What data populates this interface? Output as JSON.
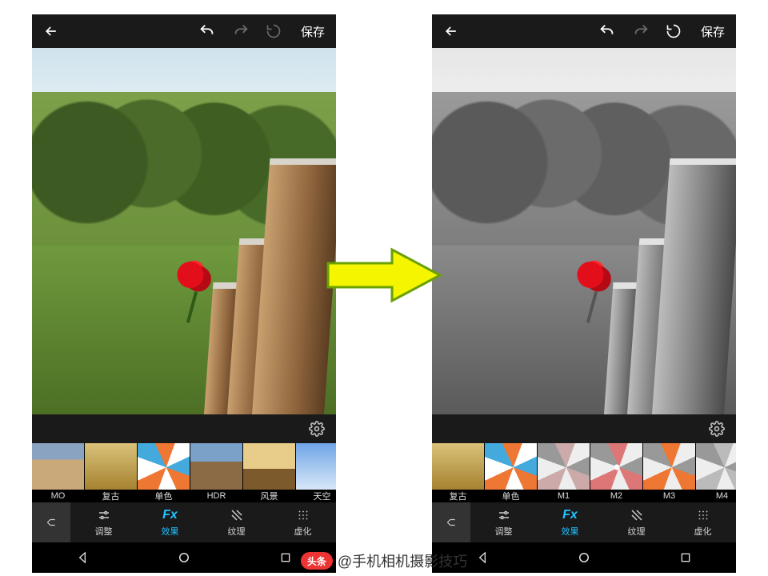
{
  "topbar": {
    "save": "保存"
  },
  "tabs": {
    "adjust": "调整",
    "effect": "效果",
    "texture": "纹理",
    "blur": "虚化",
    "effect_icon": "Fx"
  },
  "left": {
    "filters": [
      {
        "label": "MO"
      },
      {
        "label": "复古"
      },
      {
        "label": "单色"
      },
      {
        "label": "HDR"
      },
      {
        "label": "风景"
      },
      {
        "label": "天空"
      }
    ]
  },
  "right": {
    "filters": [
      {
        "label": "复古"
      },
      {
        "label": "单色"
      },
      {
        "label": "M1"
      },
      {
        "label": "M2"
      },
      {
        "label": "M3"
      },
      {
        "label": "M4"
      }
    ],
    "selected_index": 3
  },
  "footer": {
    "logo": "头条",
    "handle": "@手机相机摄影技巧"
  }
}
